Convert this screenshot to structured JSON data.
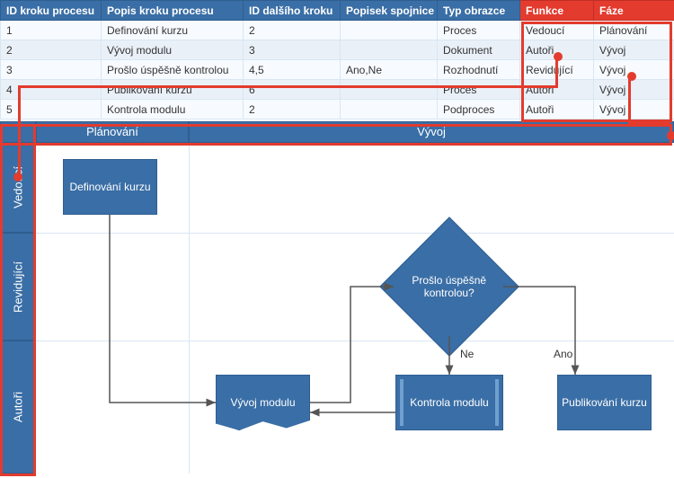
{
  "table": {
    "headers": [
      "ID kroku procesu",
      "Popis kroku procesu",
      "ID dalšího kroku",
      "Popisek spojnice",
      "Typ obrazce",
      "Funkce",
      "Fáze"
    ],
    "rows": [
      {
        "id": "1",
        "desc": "Definování kurzu",
        "next": "2",
        "conn": "",
        "shape": "Proces",
        "func": "Vedoucí",
        "phase": "Plánování"
      },
      {
        "id": "2",
        "desc": "Vývoj modulu",
        "next": "3",
        "conn": "",
        "shape": "Dokument",
        "func": "Autoři",
        "phase": "Vývoj"
      },
      {
        "id": "3",
        "desc": "Prošlo úspěšně kontrolou",
        "next": "4,5",
        "conn": "Ano,Ne",
        "shape": "Rozhodnutí",
        "func": "Revidující",
        "phase": "Vývoj"
      },
      {
        "id": "4",
        "desc": "Publikování kurzu",
        "next": "6",
        "conn": "",
        "shape": "Proces",
        "func": "Autoři",
        "phase": "Vývoj"
      },
      {
        "id": "5",
        "desc": "Kontrola modulu",
        "next": "2",
        "conn": "",
        "shape": "Podproces",
        "func": "Autoři",
        "phase": "Vývoj"
      }
    ]
  },
  "phases": [
    "Plánování",
    "Vývoj"
  ],
  "lanes": [
    "Vedoucí",
    "Revidující",
    "Autoři"
  ],
  "shapes": {
    "define": "Definování kurzu",
    "develop": "Vývoj modulu",
    "decision": "Prošlo úspěšně kontrolou?",
    "control": "Kontrola modulu",
    "publish": "Publikování kurzu"
  },
  "edge_labels": {
    "no": "Ne",
    "yes": "Ano"
  },
  "highlight_cols": [
    "Funkce",
    "Fáze"
  ]
}
